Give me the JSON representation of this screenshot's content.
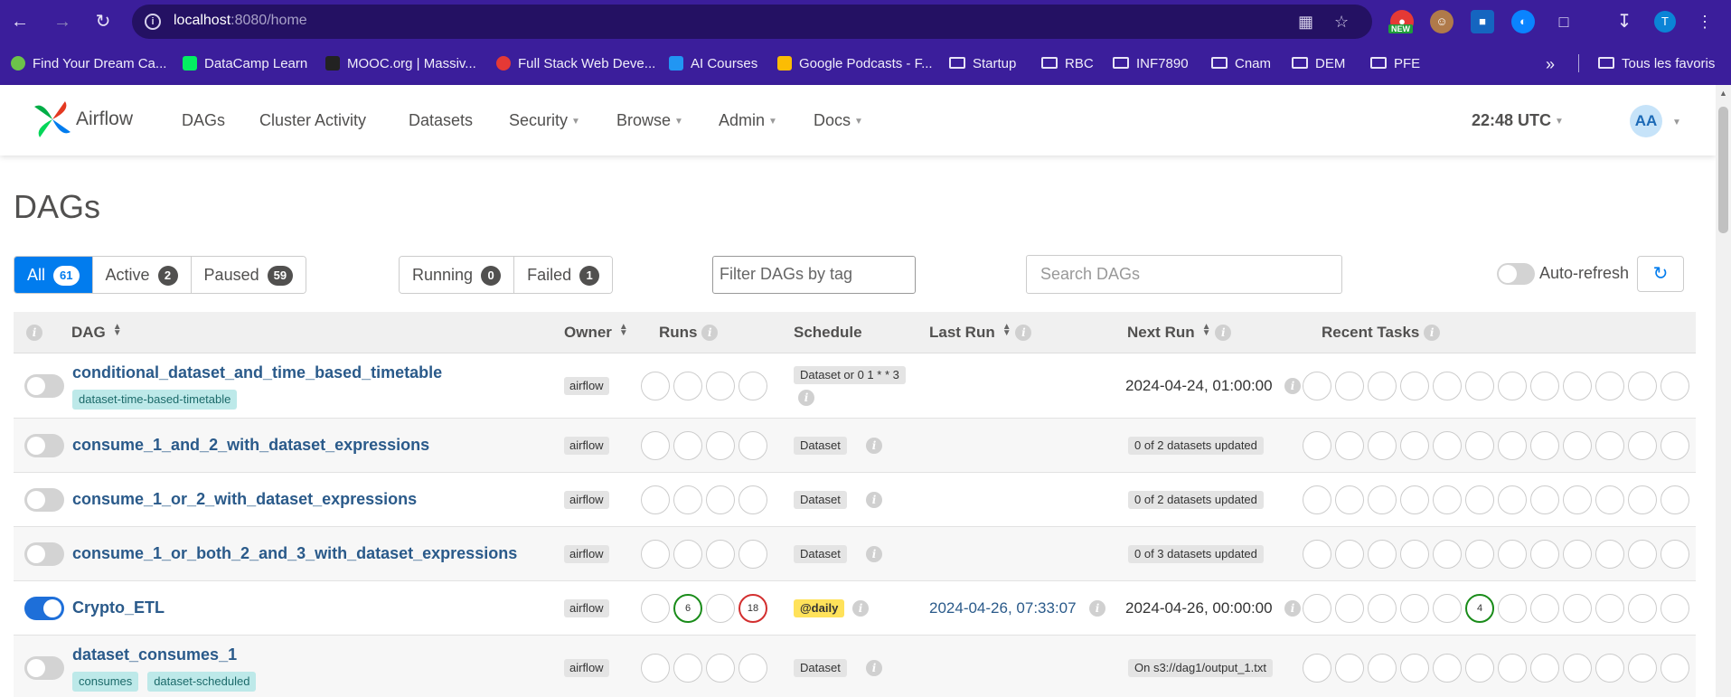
{
  "browser": {
    "url_host": "localhost",
    "url_rest": ":8080/home",
    "new_badge": "NEW",
    "profile_initial": "T",
    "bookmarks": [
      {
        "label": "Find Your Dream Ca...",
        "color": "#6cc24a"
      },
      {
        "label": "DataCamp Learn",
        "color": "#03ef62"
      },
      {
        "label": "MOOC.org | Massiv...",
        "color": "#222222"
      },
      {
        "label": "Full Stack Web Deve...",
        "color": "#e53935"
      },
      {
        "label": "AI Courses",
        "color": "#2196f3"
      },
      {
        "label": "Google Podcasts - F...",
        "color": "#fbbc04"
      },
      {
        "label": "Startup",
        "folder": true
      },
      {
        "label": "RBC",
        "folder": true
      },
      {
        "label": "INF7890",
        "folder": true
      },
      {
        "label": "Cnam",
        "folder": true
      },
      {
        "label": "DEM",
        "folder": true
      },
      {
        "label": "PFE",
        "folder": true
      }
    ],
    "more_bookmarks": "»",
    "all_bookmarks": "Tous les favoris"
  },
  "navbar": {
    "brand": "Airflow",
    "items": [
      "DAGs",
      "Cluster Activity",
      "Datasets",
      "Security",
      "Browse",
      "Admin",
      "Docs"
    ],
    "clock": "22:48 UTC",
    "avatar": "AA"
  },
  "page": {
    "title": "DAGs",
    "status_filters": [
      {
        "label": "All",
        "count": "61",
        "active": true
      },
      {
        "label": "Active",
        "count": "2"
      },
      {
        "label": "Paused",
        "count": "59"
      }
    ],
    "run_filters": [
      {
        "label": "Running",
        "count": "0"
      },
      {
        "label": "Failed",
        "count": "1"
      }
    ],
    "tag_filter_placeholder": "Filter DAGs by tag",
    "search_placeholder": "Search DAGs",
    "auto_refresh_label": "Auto-refresh"
  },
  "table": {
    "headers": {
      "dag": "DAG",
      "owner": "Owner",
      "runs": "Runs",
      "schedule": "Schedule",
      "last_run": "Last Run",
      "next_run": "Next Run",
      "recent_tasks": "Recent Tasks"
    },
    "rows": [
      {
        "name": "conditional_dataset_and_time_based_timetable",
        "tags": [
          "dataset-time-based-timetable"
        ],
        "owner": "airflow",
        "paused": true,
        "runs": [
          "",
          "",
          "",
          ""
        ],
        "schedule": "Dataset or 0 1 * * 3",
        "last_run": "",
        "next_run": "2024-04-24, 01:00:00",
        "next_badge": ""
      },
      {
        "name": "consume_1_and_2_with_dataset_expressions",
        "tags": [],
        "owner": "airflow",
        "paused": true,
        "runs": [
          "",
          "",
          "",
          ""
        ],
        "schedule": "Dataset",
        "last_run": "",
        "next_run": "",
        "next_badge": "0 of 2 datasets updated"
      },
      {
        "name": "consume_1_or_2_with_dataset_expressions",
        "tags": [],
        "owner": "airflow",
        "paused": true,
        "runs": [
          "",
          "",
          "",
          ""
        ],
        "schedule": "Dataset",
        "last_run": "",
        "next_run": "",
        "next_badge": "0 of 2 datasets updated"
      },
      {
        "name": "consume_1_or_both_2_and_3_with_dataset_expressions",
        "tags": [],
        "owner": "airflow",
        "paused": true,
        "runs": [
          "",
          "",
          "",
          ""
        ],
        "schedule": "Dataset",
        "last_run": "",
        "next_run": "",
        "next_badge": "0 of 3 datasets updated"
      },
      {
        "name": "Crypto_ETL",
        "tags": [],
        "owner": "airflow",
        "paused": false,
        "runs": [
          "",
          "6",
          "",
          "18"
        ],
        "run_states": [
          "",
          "success",
          "",
          "failed"
        ],
        "schedule": "@daily",
        "last_run": "2024-04-26, 07:33:07",
        "next_run": "2024-04-26, 00:00:00",
        "next_badge": "",
        "recent_task_counts": {
          "5": "4"
        }
      },
      {
        "name": "dataset_consumes_1",
        "tags": [
          "consumes",
          "dataset-scheduled"
        ],
        "owner": "airflow",
        "paused": true,
        "runs": [
          "",
          "",
          "",
          ""
        ],
        "schedule": "Dataset",
        "last_run": "",
        "next_run": "",
        "next_badge": "On s3://dag1/output_1.txt"
      }
    ]
  },
  "colors": {
    "browser_bar": "#3b1e9b",
    "primary": "#017cee",
    "success": "#1a8c1a",
    "failed": "#d32f2f",
    "daily_highlight": "#ffe25a"
  }
}
